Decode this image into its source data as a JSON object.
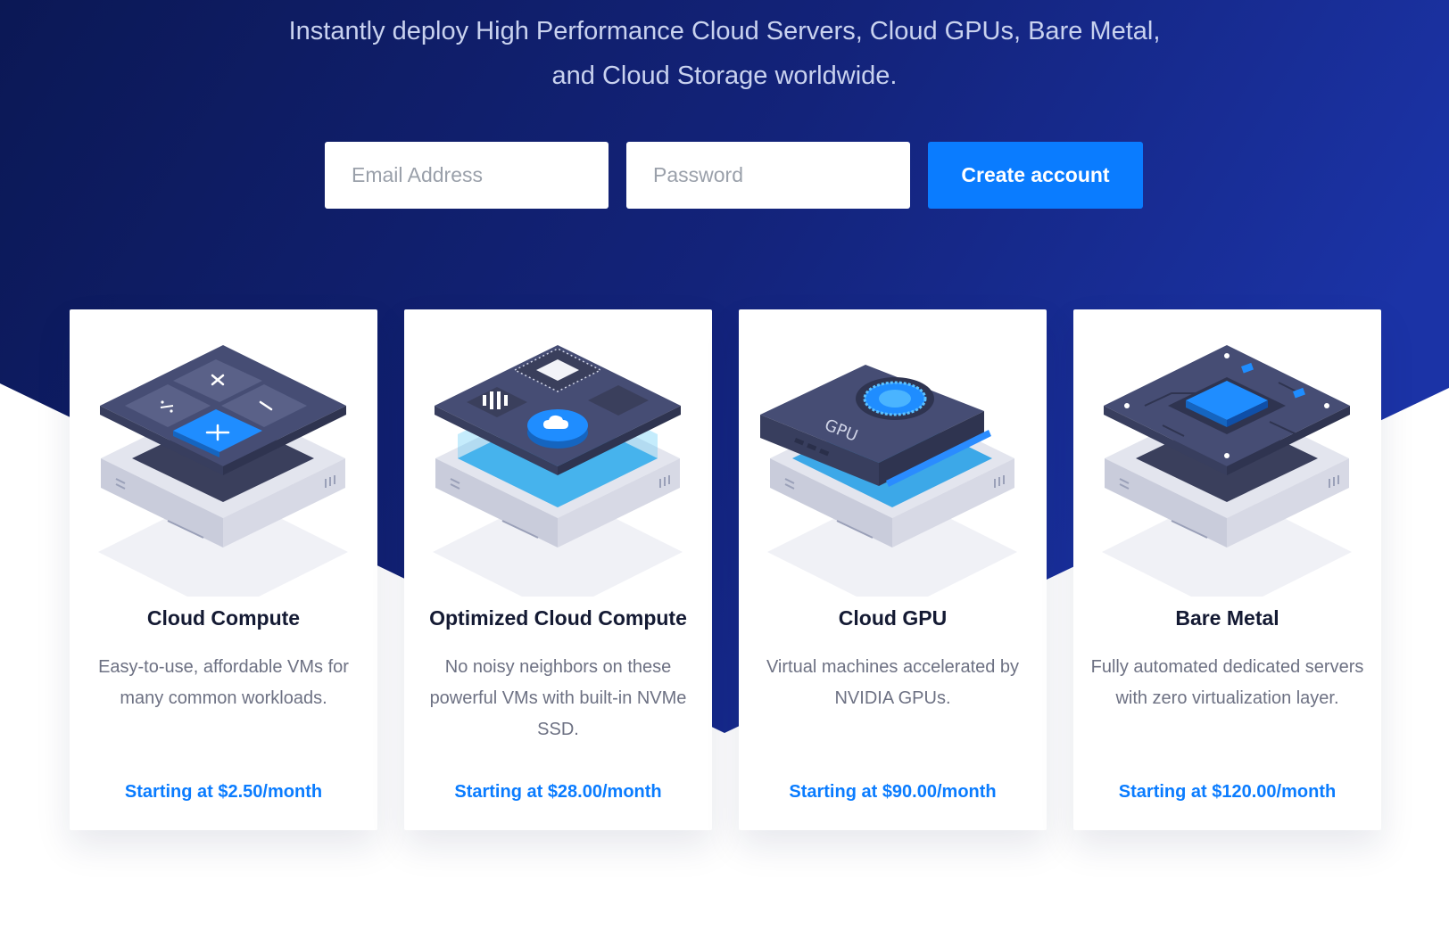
{
  "hero": {
    "tagline": "Instantly deploy High Performance Cloud Servers, Cloud GPUs, Bare Metal, and Cloud Storage worldwide."
  },
  "signup": {
    "email_placeholder": "Email Address",
    "password_placeholder": "Password",
    "button_label": "Create account"
  },
  "products": [
    {
      "title": "Cloud Compute",
      "description": "Easy-to-use, affordable VMs for many common workloads.",
      "price": "Starting at $2.50/month",
      "icon": "calculator-server-icon"
    },
    {
      "title": "Optimized Cloud Compute",
      "description": "No noisy neighbors on these powerful VMs with built-in NVMe SSD.",
      "price": "Starting at $28.00/month",
      "icon": "chip-cloud-server-icon"
    },
    {
      "title": "Cloud GPU",
      "description": "Virtual machines accelerated by NVIDIA GPUs.",
      "price": "Starting at $90.00/month",
      "icon": "gpu-card-icon",
      "illustration_text": "GPU"
    },
    {
      "title": "Bare Metal",
      "description": "Fully automated dedicated servers with zero virtualization layer.",
      "price": "Starting at $120.00/month",
      "icon": "bare-metal-board-icon"
    }
  ],
  "colors": {
    "hero_dark": "#0c1a5c",
    "hero_light": "#1a2fa0",
    "accent": "#0a7cff",
    "title_text": "#141a33",
    "body_text": "#6d7183"
  }
}
